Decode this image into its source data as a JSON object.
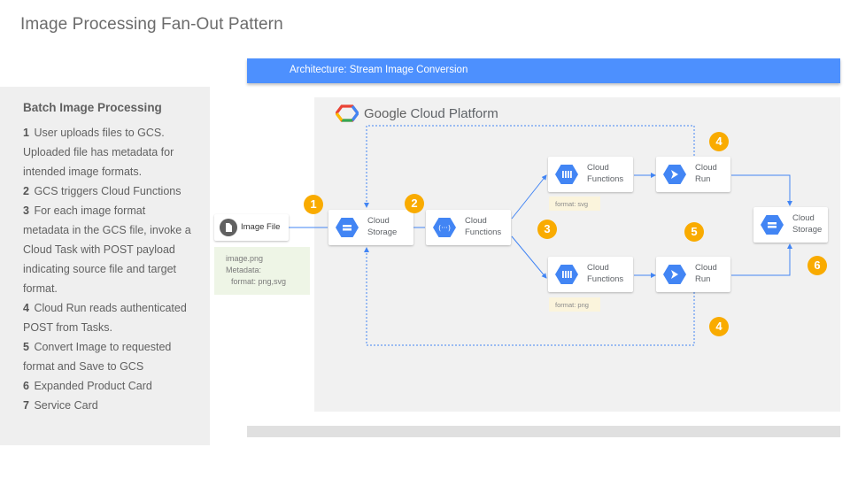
{
  "title": "Image Processing Fan-Out Pattern",
  "sidebar": {
    "heading": "Batch Image Processing",
    "steps": [
      {
        "num": "1",
        "text": "User uploads files to GCS."
      },
      {
        "num": "",
        "text": "Uploaded file has metadata for"
      },
      {
        "num": "",
        "text": "intended image formats."
      },
      {
        "num": "2",
        "text": "GCS triggers Cloud Functions"
      },
      {
        "num": "3",
        "text": "For each image format"
      },
      {
        "num": "",
        "text": "metadata in the GCS file, invoke a"
      },
      {
        "num": "",
        "text": "Cloud Task with POST payload"
      },
      {
        "num": "",
        "text": "indicating source file and target"
      },
      {
        "num": "",
        "text": "format."
      },
      {
        "num": "4",
        "text": "Cloud Run reads authenticated"
      },
      {
        "num": "",
        "text": "POST from Tasks."
      },
      {
        "num": "5",
        "text": "Convert Image to requested"
      },
      {
        "num": "",
        "text": "format and Save to GCS"
      },
      {
        "num": "6",
        "text": "Expanded Product Card"
      },
      {
        "num": "7",
        "text": "Service Card"
      }
    ]
  },
  "architecture": {
    "label": "Architecture: Stream Image Conversion"
  },
  "gcp": {
    "google": "Google",
    "platform": "Cloud Platform"
  },
  "diagram": {
    "file_node": {
      "label": "Image File"
    },
    "metadata_note": [
      "image.png",
      "Metadata:",
      "  format: png,svg"
    ],
    "storage_in": {
      "line1": "Cloud",
      "line2": "Storage"
    },
    "functions_main": {
      "line1": "Cloud",
      "line2": "Functions"
    },
    "task_top": {
      "line1": "Cloud",
      "line2": "Functions"
    },
    "task_bottom": {
      "line1": "Cloud",
      "line2": "Functions"
    },
    "run_top": {
      "line1": "Cloud",
      "line2": "Run"
    },
    "run_bottom": {
      "line1": "Cloud",
      "line2": "Run"
    },
    "storage_out": {
      "line1": "Cloud",
      "line2": "Storage"
    },
    "format_svg": "format: svg",
    "format_png": "format: png",
    "badges": {
      "b1": "1",
      "b2": "2",
      "b3": "3",
      "b4_top": "4",
      "b5": "5",
      "b6": "6",
      "b4_bottom": "4"
    }
  },
  "colors": {
    "accent": "#4d90fe",
    "badge": "#f9ab00",
    "icon_blue": "#4285f4",
    "connector": "#4285f4"
  }
}
